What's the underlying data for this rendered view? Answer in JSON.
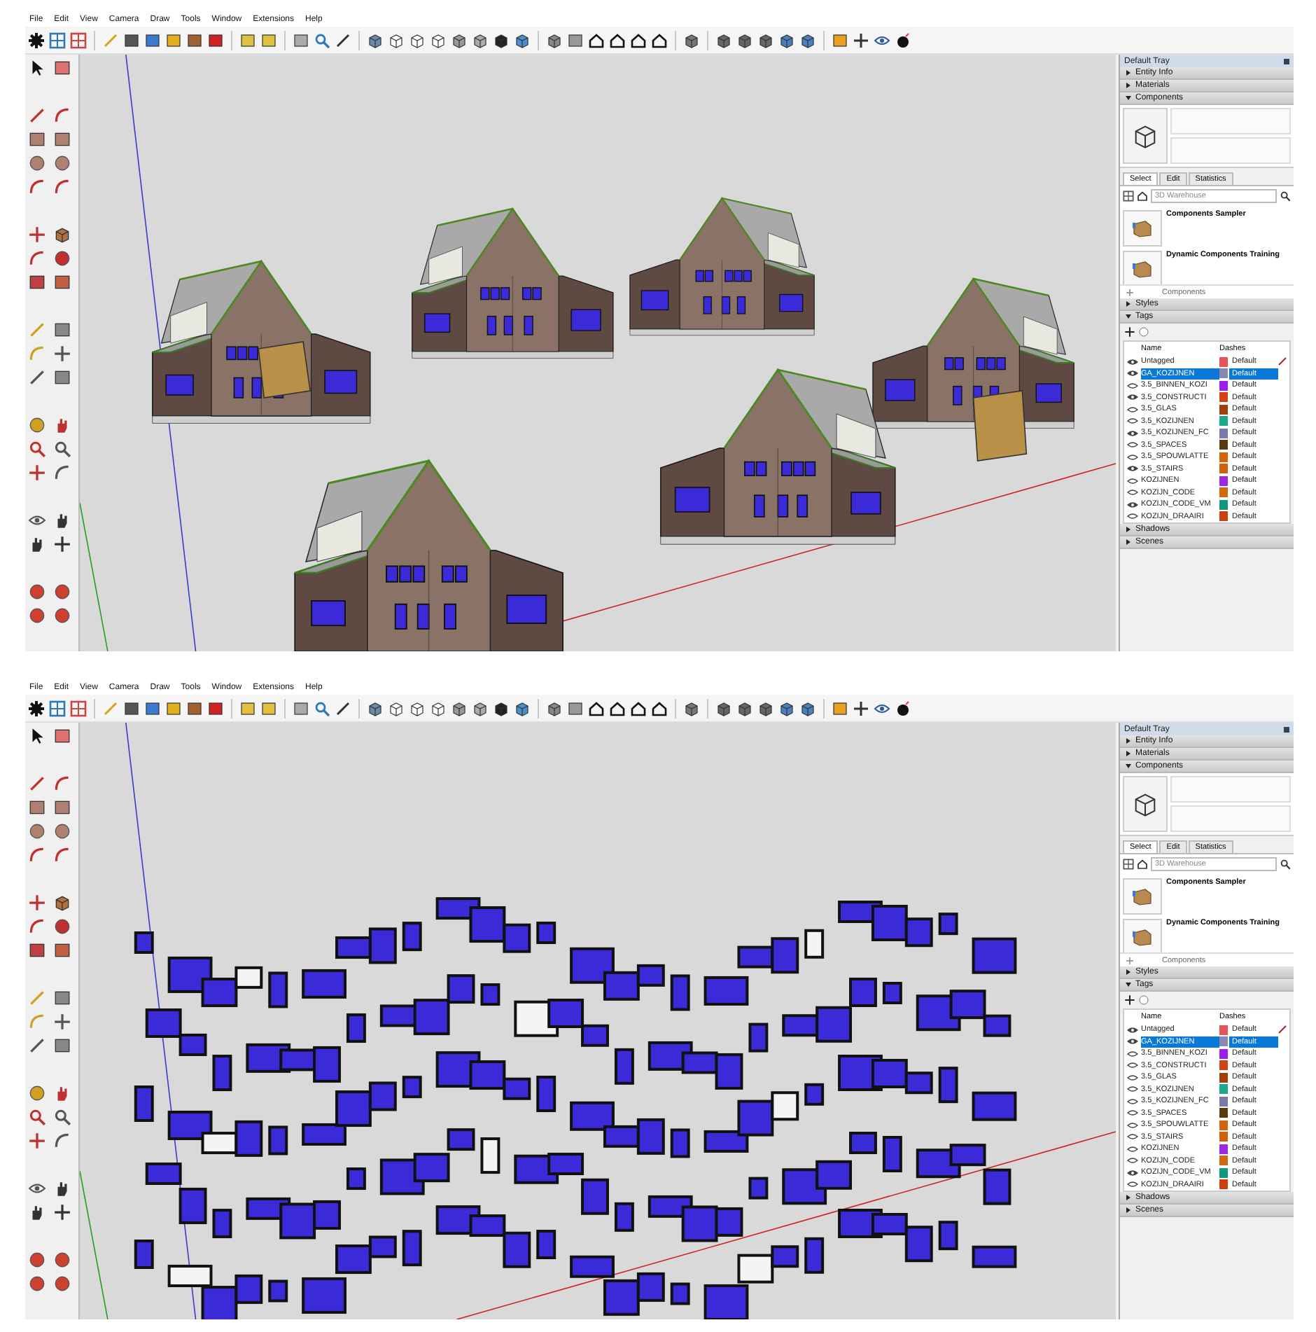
{
  "windows": [
    {
      "menu": [
        "File",
        "Edit",
        "View",
        "Camera",
        "Draw",
        "Tools",
        "Window",
        "Extensions",
        "Help"
      ],
      "viewport": {
        "kind": "houses"
      },
      "tray": {
        "title": "Default Tray",
        "sections": [
          {
            "label": "Entity Info",
            "expanded": false
          },
          {
            "label": "Materials",
            "expanded": false
          },
          {
            "kind": "components",
            "label": "Components",
            "expanded": true,
            "tabs": [
              {
                "label": "Select",
                "selected": true
              },
              {
                "label": "Edit",
                "selected": false
              },
              {
                "label": "Statistics",
                "selected": false
              }
            ],
            "search": {
              "placeholder": "3D Warehouse"
            },
            "items": [
              {
                "name": "Components Sampler"
              },
              {
                "name": "Dynamic Components Training"
              }
            ],
            "footer": "Components"
          },
          {
            "label": "Styles",
            "expanded": false
          },
          {
            "kind": "tags",
            "label": "Tags",
            "expanded": true,
            "columns": [
              "Name",
              "Dashes"
            ],
            "rows": [
              {
                "name": "Untagged",
                "visible": true,
                "selected": false,
                "current": true,
                "color": "#e8535a",
                "dashes": "Default"
              },
              {
                "name": "GA_KOZIJNEN",
                "visible": true,
                "selected": true,
                "current": false,
                "color": "#8a87b0",
                "dashes": "Default"
              },
              {
                "name": "3.5_BINNEN_KOZI",
                "visible": false,
                "selected": false,
                "current": false,
                "color": "#9b1fe8",
                "dashes": "Default"
              },
              {
                "name": "3.5_CONSTRUCTI",
                "visible": true,
                "selected": false,
                "current": false,
                "color": "#d2440f",
                "dashes": "Default"
              },
              {
                "name": "3.5_GLAS",
                "visible": false,
                "selected": false,
                "current": false,
                "color": "#a0400c",
                "dashes": "Default"
              },
              {
                "name": "3.5_KOZIJNEN",
                "visible": false,
                "selected": false,
                "current": false,
                "color": "#1aa88e",
                "dashes": "Default"
              },
              {
                "name": "3.5_KOZIJNEN_FC",
                "visible": true,
                "selected": false,
                "current": false,
                "color": "#7a7aa8",
                "dashes": "Default"
              },
              {
                "name": "3.5_SPACES",
                "visible": false,
                "selected": false,
                "current": false,
                "color": "#5a3a10",
                "dashes": "Default"
              },
              {
                "name": "3.5_SPOUWLATTE",
                "visible": false,
                "selected": false,
                "current": false,
                "color": "#d0650e",
                "dashes": "Default"
              },
              {
                "name": "3.5_STAIRS",
                "visible": true,
                "selected": false,
                "current": false,
                "color": "#d0600e",
                "dashes": "Default"
              },
              {
                "name": "KOZIJNEN",
                "visible": false,
                "selected": false,
                "current": false,
                "color": "#9a2ae0",
                "dashes": "Default"
              },
              {
                "name": "KOZIJN_CODE",
                "visible": false,
                "selected": false,
                "current": false,
                "color": "#d06810",
                "dashes": "Default"
              },
              {
                "name": "KOZIJN_CODE_VM",
                "visible": true,
                "selected": false,
                "current": false,
                "color": "#109880",
                "dashes": "Default"
              },
              {
                "name": "KOZIJN_DRAAIRI",
                "visible": false,
                "selected": false,
                "current": false,
                "color": "#cc4010",
                "dashes": "Default"
              }
            ]
          },
          {
            "label": "Shadows",
            "expanded": false
          },
          {
            "label": "Scenes",
            "expanded": false
          }
        ]
      }
    },
    {
      "menu": [
        "File",
        "Edit",
        "View",
        "Camera",
        "Draw",
        "Tools",
        "Window",
        "Extensions",
        "Help"
      ],
      "viewport": {
        "kind": "windows"
      },
      "tray": {
        "title": "Default Tray",
        "sections": [
          {
            "label": "Entity Info",
            "expanded": false
          },
          {
            "label": "Materials",
            "expanded": false
          },
          {
            "kind": "components",
            "label": "Components",
            "expanded": true,
            "tabs": [
              {
                "label": "Select",
                "selected": true
              },
              {
                "label": "Edit",
                "selected": false
              },
              {
                "label": "Statistics",
                "selected": false
              }
            ],
            "search": {
              "placeholder": "3D Warehouse"
            },
            "items": [
              {
                "name": "Components Sampler"
              },
              {
                "name": "Dynamic Components Training"
              }
            ],
            "footer": "Components"
          },
          {
            "label": "Styles",
            "expanded": false
          },
          {
            "kind": "tags",
            "label": "Tags",
            "expanded": true,
            "columns": [
              "Name",
              "Dashes"
            ],
            "rows": [
              {
                "name": "Untagged",
                "visible": true,
                "selected": false,
                "current": true,
                "color": "#e8535a",
                "dashes": "Default"
              },
              {
                "name": "GA_KOZIJNEN",
                "visible": true,
                "selected": true,
                "current": false,
                "color": "#8a87b0",
                "dashes": "Default"
              },
              {
                "name": "3.5_BINNEN_KOZI",
                "visible": false,
                "selected": false,
                "current": false,
                "color": "#9b1fe8",
                "dashes": "Default"
              },
              {
                "name": "3.5_CONSTRUCTI",
                "visible": false,
                "selected": false,
                "current": false,
                "color": "#d2440f",
                "dashes": "Default"
              },
              {
                "name": "3.5_GLAS",
                "visible": false,
                "selected": false,
                "current": false,
                "color": "#a0400c",
                "dashes": "Default"
              },
              {
                "name": "3.5_KOZIJNEN",
                "visible": false,
                "selected": false,
                "current": false,
                "color": "#1aa88e",
                "dashes": "Default"
              },
              {
                "name": "3.5_KOZIJNEN_FC",
                "visible": false,
                "selected": false,
                "current": false,
                "color": "#7a7aa8",
                "dashes": "Default"
              },
              {
                "name": "3.5_SPACES",
                "visible": false,
                "selected": false,
                "current": false,
                "color": "#5a3a10",
                "dashes": "Default"
              },
              {
                "name": "3.5_SPOUWLATTE",
                "visible": false,
                "selected": false,
                "current": false,
                "color": "#d0650e",
                "dashes": "Default"
              },
              {
                "name": "3.5_STAIRS",
                "visible": false,
                "selected": false,
                "current": false,
                "color": "#d0600e",
                "dashes": "Default"
              },
              {
                "name": "KOZIJNEN",
                "visible": false,
                "selected": false,
                "current": false,
                "color": "#9a2ae0",
                "dashes": "Default"
              },
              {
                "name": "KOZIJN_CODE",
                "visible": false,
                "selected": false,
                "current": false,
                "color": "#d06810",
                "dashes": "Default"
              },
              {
                "name": "KOZIJN_CODE_VM",
                "visible": true,
                "selected": false,
                "current": false,
                "color": "#109880",
                "dashes": "Default"
              },
              {
                "name": "KOZIJN_DRAAIRI",
                "visible": false,
                "selected": false,
                "current": false,
                "color": "#cc4010",
                "dashes": "Default"
              }
            ]
          },
          {
            "label": "Shadows",
            "expanded": false
          },
          {
            "label": "Scenes",
            "expanded": false
          }
        ]
      }
    }
  ]
}
